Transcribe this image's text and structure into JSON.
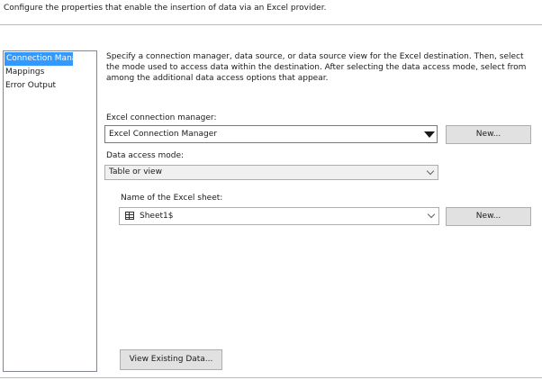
{
  "header": {
    "text": "Configure the properties that enable the insertion of data via an Excel provider."
  },
  "nav": {
    "items": [
      {
        "label": "Connection Manager",
        "selected": true
      },
      {
        "label": "Mappings",
        "selected": false
      },
      {
        "label": "Error Output",
        "selected": false
      }
    ]
  },
  "main": {
    "description": "Specify a connection manager, data source, or data source view for the Excel destination. Then, select the mode used to access data within the destination. After selecting the data access mode, select from among the additional data access options that appear.",
    "connection_manager_label": "Excel connection manager:",
    "connection_manager_value": "Excel Connection Manager",
    "new_button_1": "New...",
    "data_access_mode_label": "Data access mode:",
    "data_access_mode_value": "Table or view",
    "sheet_label": "Name of the Excel sheet:",
    "sheet_value": "Sheet1$",
    "sheet_icon": "table-icon",
    "new_button_2": "New...",
    "view_data_button": "View Existing Data..."
  }
}
